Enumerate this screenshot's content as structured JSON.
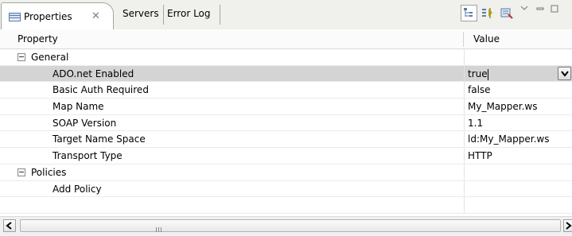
{
  "tabs": {
    "active": {
      "label": "Properties",
      "icon": "properties-view-icon"
    },
    "others": [
      {
        "label": "Servers"
      },
      {
        "label": "Error Log"
      }
    ]
  },
  "toolbar": {
    "icons": [
      "show-categories-icon",
      "show-advanced-icon",
      "restore-default-icon",
      "view-menu-icon",
      "minimize-icon",
      "maximize-icon"
    ]
  },
  "table": {
    "columns": {
      "property": "Property",
      "value": "Value"
    },
    "categories": [
      {
        "label": "General",
        "expanded": true,
        "rows": [
          {
            "name": "ADO.net Enabled",
            "value": "true",
            "selected": true,
            "editor": "combo"
          },
          {
            "name": "Basic Auth Required",
            "value": "false"
          },
          {
            "name": "Map Name",
            "value": "My_Mapper.ws"
          },
          {
            "name": "SOAP Version",
            "value": "1.1"
          },
          {
            "name": "Target Name Space",
            "value": "ld:My_Mapper.ws"
          },
          {
            "name": "Transport Type",
            "value": "HTTP"
          }
        ]
      },
      {
        "label": "Policies",
        "expanded": true,
        "rows": [
          {
            "name": "Add Policy",
            "value": ""
          }
        ]
      }
    ]
  },
  "colors": {
    "tabbar_bg": "#f0f0ec",
    "selected_row": "#d4d4d4",
    "icon_blue": "#5a7ca5"
  }
}
